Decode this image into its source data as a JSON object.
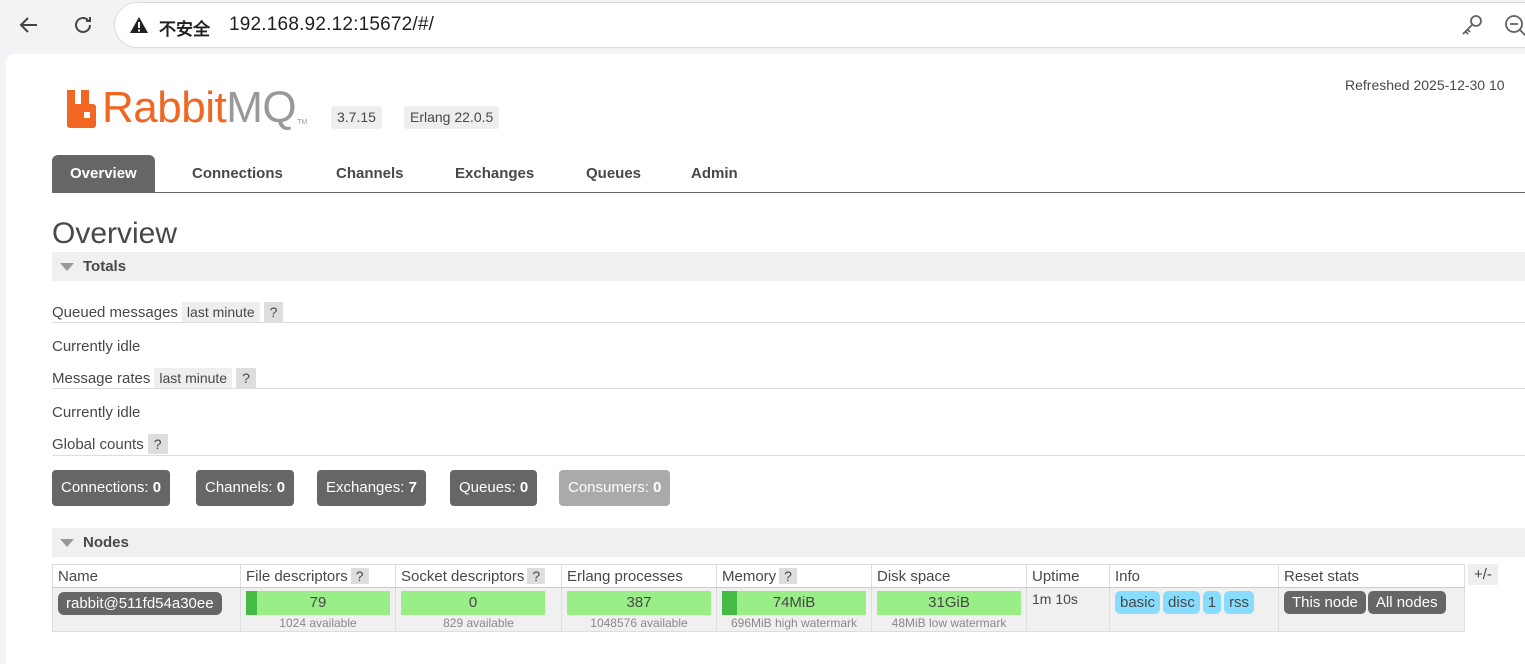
{
  "browser": {
    "insecure_label": "不安全",
    "url": "192.168.92.12:15672/#/"
  },
  "header": {
    "logo_rabbit": "Rabbit",
    "logo_mq": "MQ",
    "logo_tm": "TM",
    "rabbitmq_version": "3.7.15",
    "erlang_version": "Erlang 22.0.5",
    "refreshed": "Refreshed 2025-12-30 10"
  },
  "tabs": [
    {
      "label": "Overview"
    },
    {
      "label": "Connections"
    },
    {
      "label": "Channels"
    },
    {
      "label": "Exchanges"
    },
    {
      "label": "Queues"
    },
    {
      "label": "Admin"
    }
  ],
  "page_title": "Overview",
  "totals": {
    "heading": "Totals",
    "queued_messages_label": "Queued messages",
    "queued_range": "last minute",
    "help": "?",
    "queued_status": "Currently idle",
    "message_rates_label": "Message rates",
    "rates_range": "last minute",
    "rates_status": "Currently idle",
    "global_counts_label": "Global counts"
  },
  "counts": [
    {
      "label": "Connections:",
      "value": "0"
    },
    {
      "label": "Channels:",
      "value": "0"
    },
    {
      "label": "Exchanges:",
      "value": "7"
    },
    {
      "label": "Queues:",
      "value": "0"
    },
    {
      "label": "Consumers:",
      "value": "0"
    }
  ],
  "nodes": {
    "heading": "Nodes",
    "plus_minus": "+/-",
    "columns": {
      "name": "Name",
      "file_descriptors": "File descriptors",
      "socket_descriptors": "Socket descriptors",
      "erlang_processes": "Erlang processes",
      "memory": "Memory",
      "disk_space": "Disk space",
      "uptime": "Uptime",
      "info": "Info",
      "reset_stats": "Reset stats"
    },
    "row": {
      "name": "rabbit@511fd54a30ee",
      "fd_value": "79",
      "fd_sub": "1024 available",
      "fd_fraction": 0.077,
      "socket_value": "0",
      "socket_sub": "829 available",
      "socket_fraction": 0,
      "proc_value": "387",
      "proc_sub": "1048576 available",
      "proc_fraction": 0.0004,
      "mem_value": "74MiB",
      "mem_sub": "696MiB high watermark",
      "mem_fraction": 0.106,
      "disk_value": "31GiB",
      "disk_sub": "48MiB low watermark",
      "uptime": "1m 10s",
      "info": [
        "basic",
        "disc",
        "1",
        "rss"
      ],
      "reset_this": "This node",
      "reset_all": "All nodes"
    }
  }
}
